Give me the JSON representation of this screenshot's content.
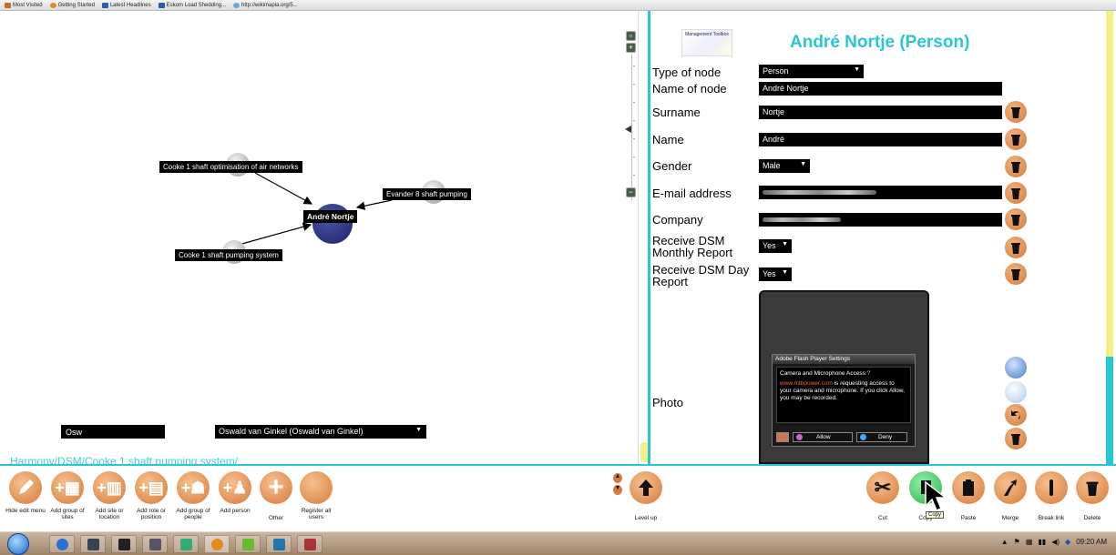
{
  "bookmarks": [
    "Most Visited",
    "Getting Started",
    "Latest Headlines",
    "Eskom Load Shedding...",
    "http://wikimapia.org/5..."
  ],
  "graph": {
    "center_node": "André Nortje",
    "nodes": [
      "Cooke 1 shaft optimisation of air networks",
      "Evander 8 shaft pumping",
      "Cooke 1 shaft pumping system"
    ],
    "zoom_in": "+",
    "zoom_out": "−"
  },
  "filter": {
    "value": "Osw"
  },
  "user_select": {
    "value": "Oswald van Ginkel (Oswald van Ginkel)"
  },
  "breadcrumb": "Harmony/DSM/Cooke 1 shaft pumping system/",
  "form": {
    "logo_text": "Management Toolbox",
    "title": "André Nortje (Person)",
    "type_of_node": {
      "label": "Type of node",
      "value": "Person"
    },
    "name_of_node": {
      "label": "Name of node",
      "value": "André Nortje"
    },
    "surname": {
      "label": "Surname",
      "value": "Nortje"
    },
    "name": {
      "label": "Name",
      "value": "André"
    },
    "gender": {
      "label": "Gender",
      "value": "Male"
    },
    "email": {
      "label": "E-mail address"
    },
    "company": {
      "label": "Company"
    },
    "monthly_report": {
      "label": "Receive DSM Monthly Report",
      "value": "Yes"
    },
    "day_report": {
      "label": "Receive DSM Day Report",
      "value": "Yes"
    },
    "photo": {
      "label": "Photo"
    }
  },
  "flash": {
    "title": "Adobe Flash Player Settings",
    "heading": "Camera and Microphone Access",
    "site": "www.mtbpower.com",
    "message": "is requesting access to your camera and microphone. If you click Allow, you may be recorded.",
    "allow": "Allow",
    "deny": "Deny"
  },
  "toolbar": {
    "left": [
      {
        "label": "Hide edit menu",
        "icon": "pencil-icon"
      },
      {
        "label": "Add group of sites",
        "icon": "add-group-sites-icon"
      },
      {
        "label": "Add site or location",
        "icon": "add-site-icon"
      },
      {
        "label": "Add role or position",
        "icon": "add-role-icon"
      },
      {
        "label": "Add group of people",
        "icon": "add-group-people-icon"
      },
      {
        "label": "Add person",
        "icon": "add-person-icon"
      },
      {
        "label": "Other",
        "icon": "plus-icon"
      },
      {
        "label": "Register all users",
        "icon": "register-icon"
      }
    ],
    "level_up": "Level up",
    "right": [
      {
        "label": "Cut",
        "icon": "scissors-icon"
      },
      {
        "label": "Copy",
        "icon": "copy-icon"
      },
      {
        "label": "Paste",
        "icon": "paste-icon"
      },
      {
        "label": "Merge",
        "icon": "merge-icon"
      },
      {
        "label": "Break link",
        "icon": "break-link-icon"
      },
      {
        "label": "Delete",
        "icon": "trash-icon"
      }
    ],
    "copy_tooltip": "Copy"
  },
  "taskbar": {
    "time": "09:20 AM"
  },
  "colors": {
    "accent": "#29c7d1",
    "button": "#d77b3a",
    "highlight": "#f3f08c"
  }
}
